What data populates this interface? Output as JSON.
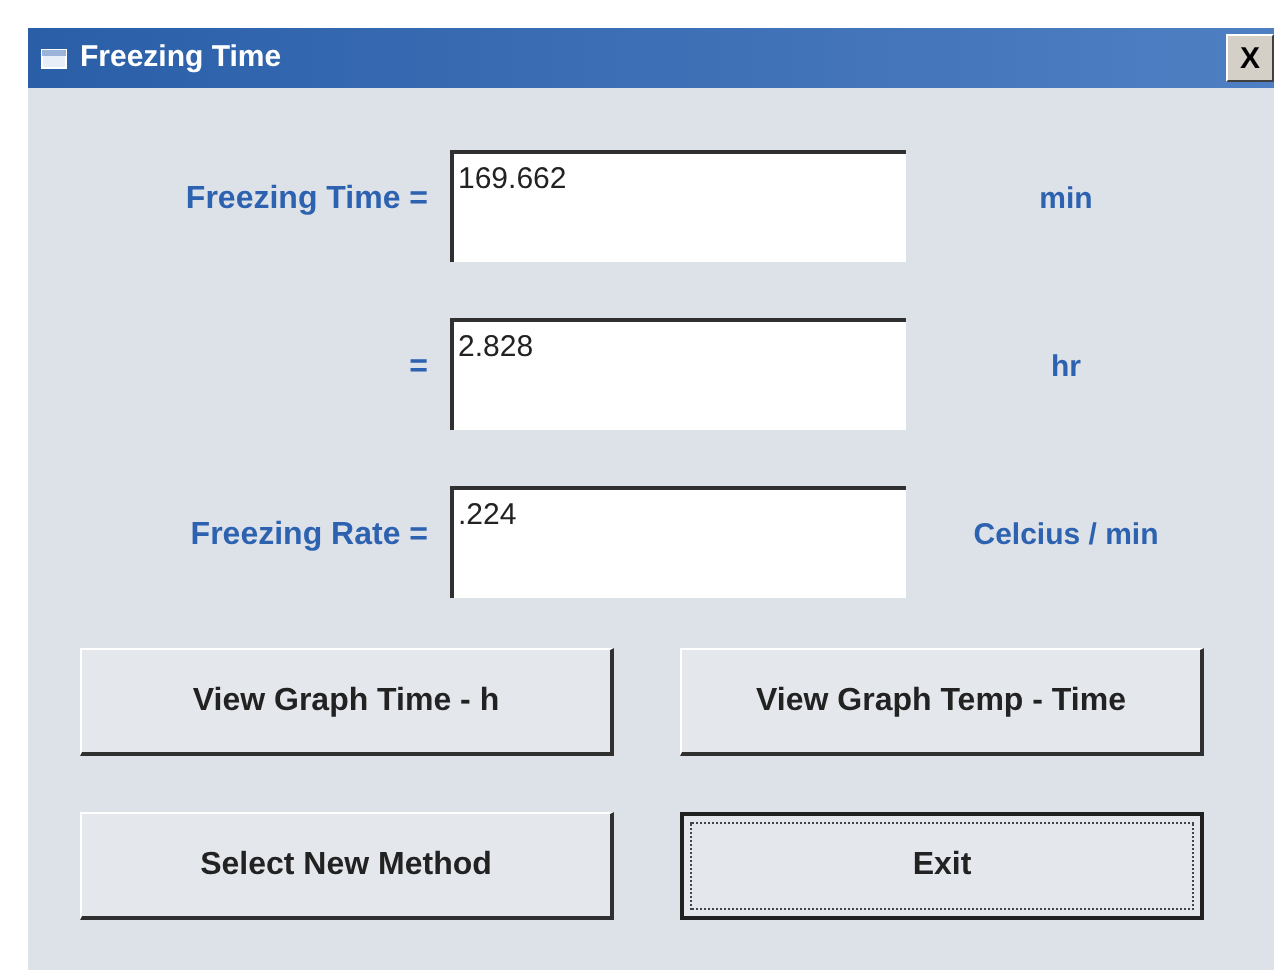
{
  "window": {
    "title": "Freezing Time",
    "close": "X"
  },
  "rows": [
    {
      "label": "Freezing Time =",
      "value": "169.662",
      "unit": "min"
    },
    {
      "label": "=",
      "value": "2.828",
      "unit": "hr"
    },
    {
      "label": "Freezing Rate =",
      "value": ".224",
      "unit": "Celcius / min"
    }
  ],
  "buttons": [
    {
      "label": "View Graph Time - h",
      "focused": false
    },
    {
      "label": "View Graph Temp - Time",
      "focused": false
    },
    {
      "label": "Select New Method",
      "focused": false
    },
    {
      "label": "Exit",
      "focused": true
    }
  ]
}
